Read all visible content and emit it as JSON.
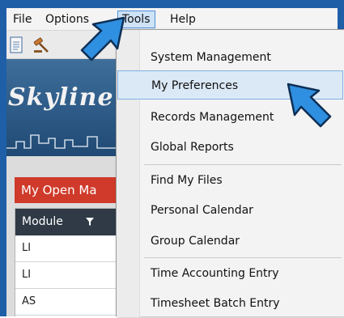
{
  "menubar": {
    "items": [
      {
        "label": "File"
      },
      {
        "label": "Options"
      },
      {
        "label": "Tools"
      },
      {
        "label": "Help"
      }
    ]
  },
  "banner": {
    "brand": "Skyline"
  },
  "panel": {
    "title": "My Open Ma"
  },
  "grid": {
    "header": "Module",
    "rows": [
      "LI",
      "LI",
      "AS"
    ]
  },
  "dropdown": {
    "items": [
      {
        "label": "System Management"
      },
      {
        "label": "My Preferences"
      },
      {
        "label": "Records Management"
      },
      {
        "label": "Global Reports"
      },
      {
        "label": "Find My Files"
      },
      {
        "label": "Personal Calendar"
      },
      {
        "label": "Group Calendar"
      },
      {
        "label": "Time Accounting Entry"
      },
      {
        "label": "Timesheet Batch Entry"
      }
    ],
    "highlighted_index": 1
  },
  "colors": {
    "accent_border": "#1f5fa8",
    "arrow": "#2f8fe0",
    "panel_header": "#cf3a2a",
    "banner": "#2d5a86"
  }
}
